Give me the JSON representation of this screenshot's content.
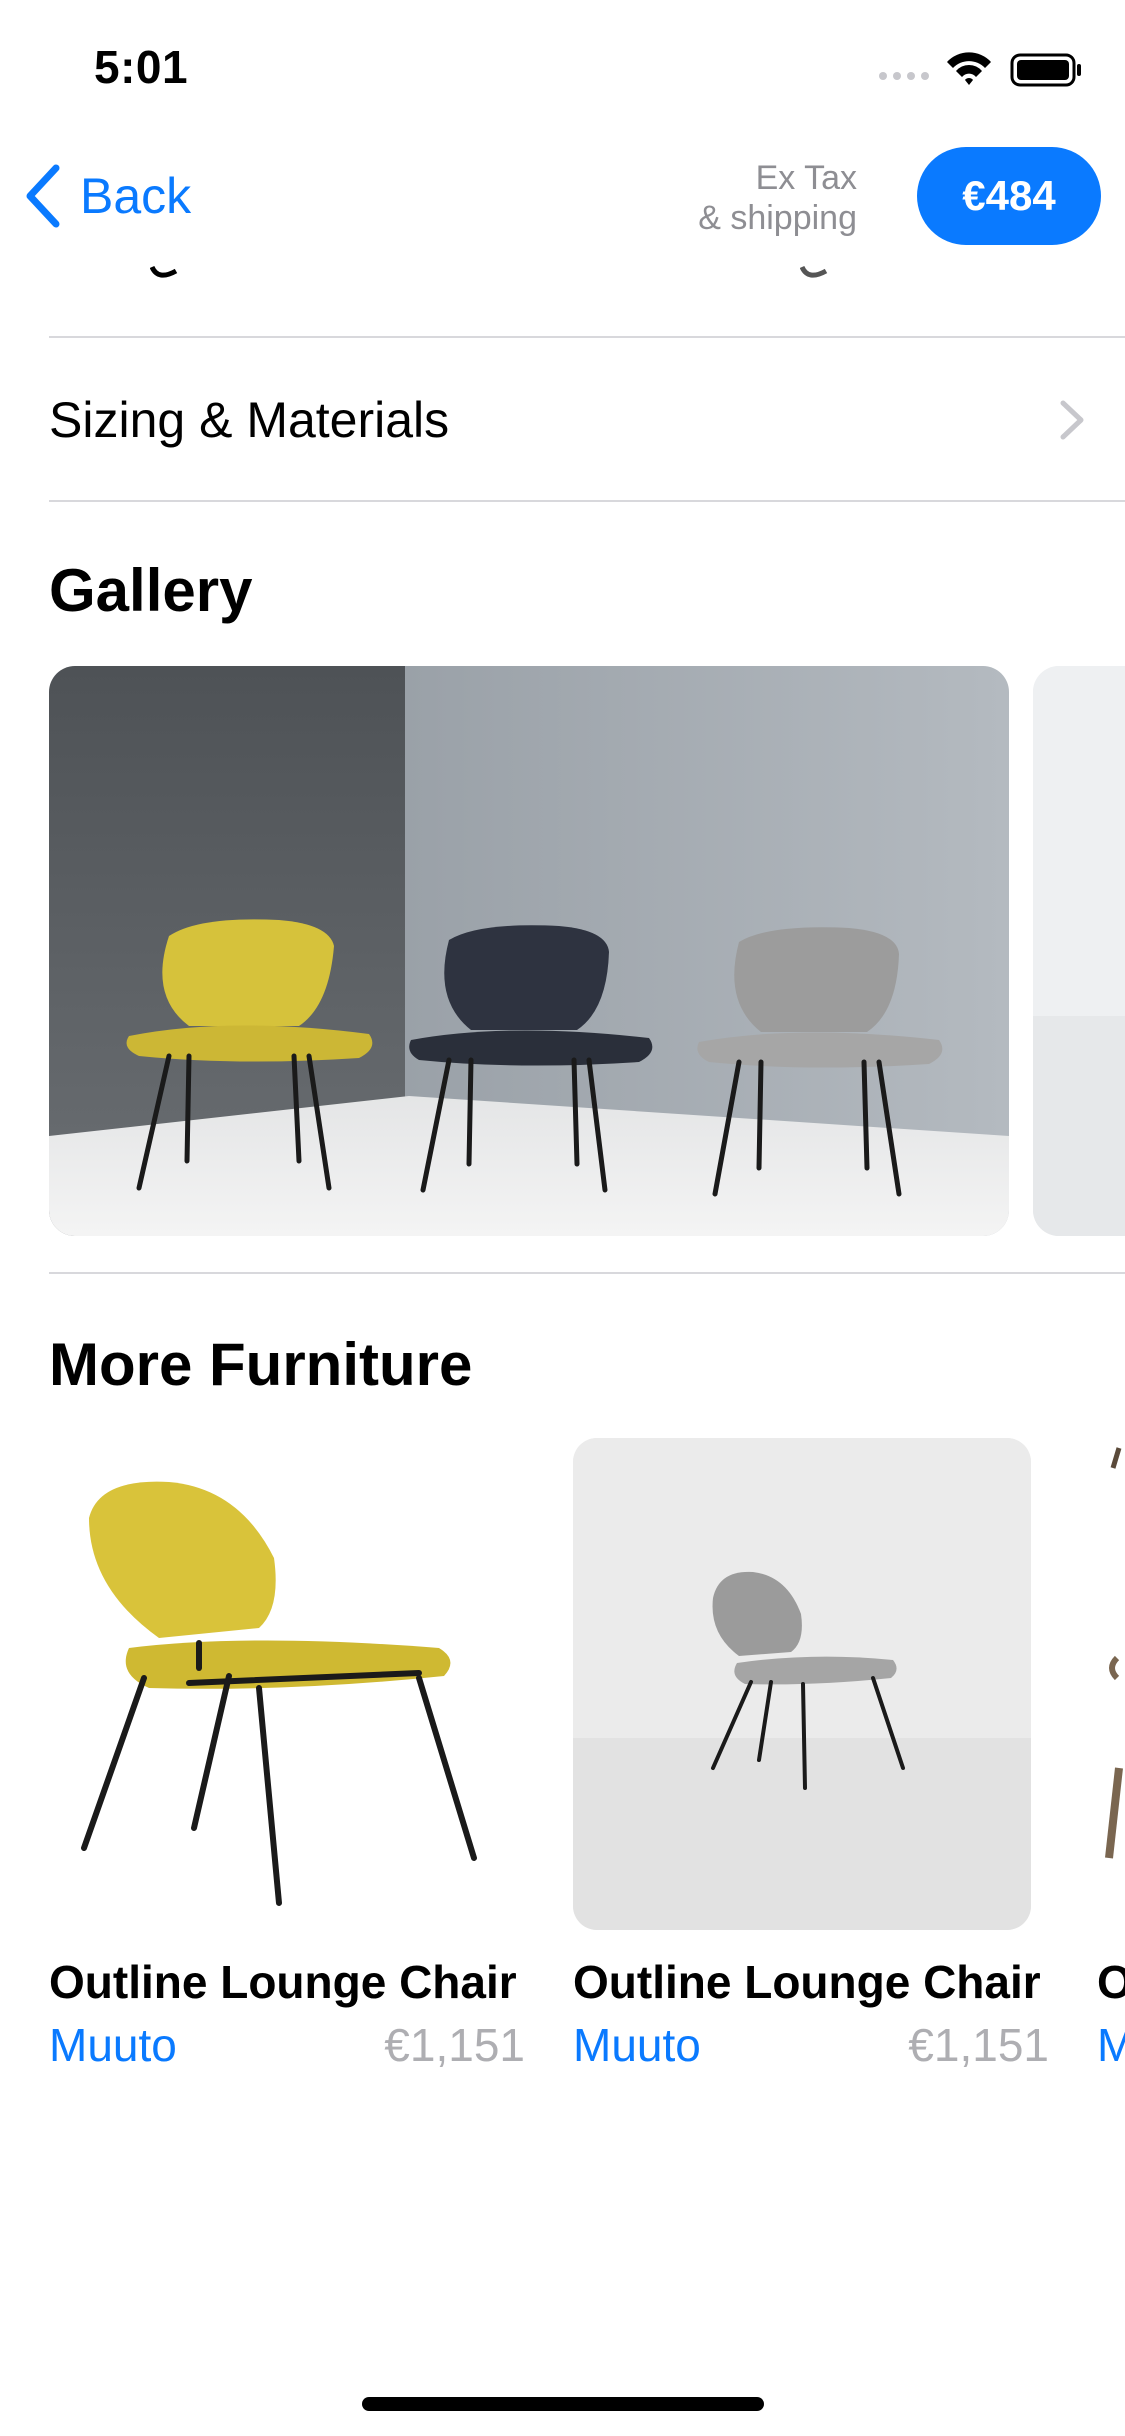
{
  "status_bar": {
    "time": "5:01"
  },
  "nav": {
    "back_label": "Back",
    "tax_line1": "Ex Tax",
    "tax_line2": "& shipping",
    "price": "€484"
  },
  "sizing_row": {
    "label": "Sizing & Materials"
  },
  "gallery": {
    "title": "Gallery"
  },
  "more_furniture": {
    "title": "More Furniture",
    "items": [
      {
        "name": "Outline Lounge Chair",
        "brand": "Muuto",
        "price": "€1,151"
      },
      {
        "name": "Outline Lounge Chair",
        "brand": "Muuto",
        "price": "€1,151"
      },
      {
        "name": "O",
        "brand": "M"
      }
    ]
  },
  "colors": {
    "accent": "#0A7AFF",
    "divider": "#D8D8DC",
    "secondary_text": "#8E8E93",
    "price_text": "#AEAEB2"
  },
  "icons": [
    "wifi-icon",
    "battery-icon",
    "signal-icon",
    "back-chevron-icon",
    "chevron-right-icon"
  ]
}
